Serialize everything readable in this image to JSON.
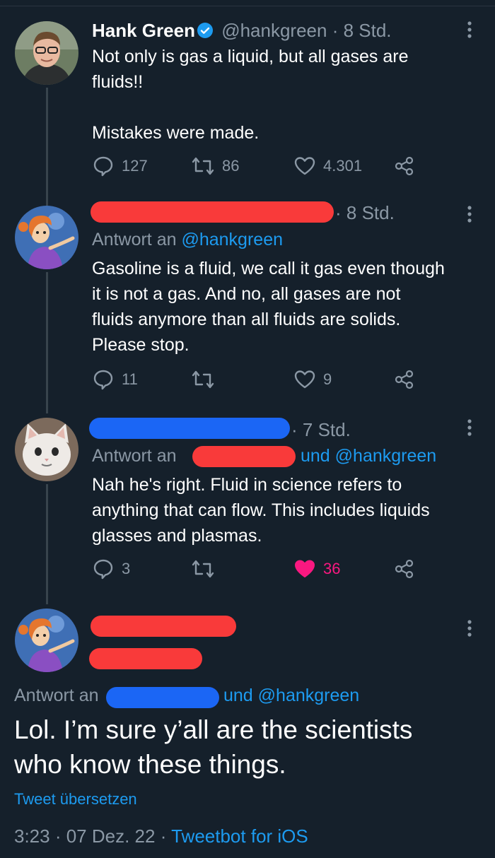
{
  "colors": {
    "background": "#15202b",
    "text": "#ffffff",
    "muted": "#8b98a5",
    "link": "#1d9bf0",
    "like": "#f91880",
    "redaction_red": "#f93a3a",
    "redaction_blue": "#1b66f5"
  },
  "tweets": [
    {
      "author_name": "Hank Green",
      "verified": true,
      "handle": "@hankgreen",
      "time": "8 Std.",
      "text": "Not only is gas a liquid, but all gases are\nfluids!!\n\nMistakes were made.",
      "replies": "127",
      "retweets": "86",
      "likes": "4.301",
      "icons": [
        "reply-icon",
        "retweet-icon",
        "like-icon",
        "share-icon",
        "more-icon"
      ]
    },
    {
      "time": "8 Std.",
      "reply_prefix": "Antwort an",
      "reply_handle": "@hankgreen",
      "text": "Gasoline is a fluid, we call it gas even though\nit is not a gas. And no, all gases are not\nfluids anymore than all fluids are solids.\nPlease stop.",
      "replies": "11",
      "retweets": "",
      "likes": "9"
    },
    {
      "time": "7 Std.",
      "reply_prefix": "Antwort an",
      "reply_joiner": "und",
      "reply_handle": "@hankgreen",
      "text": "Nah he's right. Fluid in science refers to\nanything that can flow. This includes liquids\nglasses and plasmas.",
      "replies": "3",
      "retweets": "",
      "likes": "36",
      "liked": true
    }
  ],
  "focus_tweet": {
    "reply_prefix": "Antwort an",
    "reply_joiner": "und",
    "reply_handle": "@hankgreen",
    "text": "Lol. I’m sure y’all are the scientists\nwho know these things.",
    "translate_label": "Tweet übersetzen",
    "time": "3:23",
    "date": "07 Dez. 22",
    "client": "Tweetbot for iOS"
  }
}
